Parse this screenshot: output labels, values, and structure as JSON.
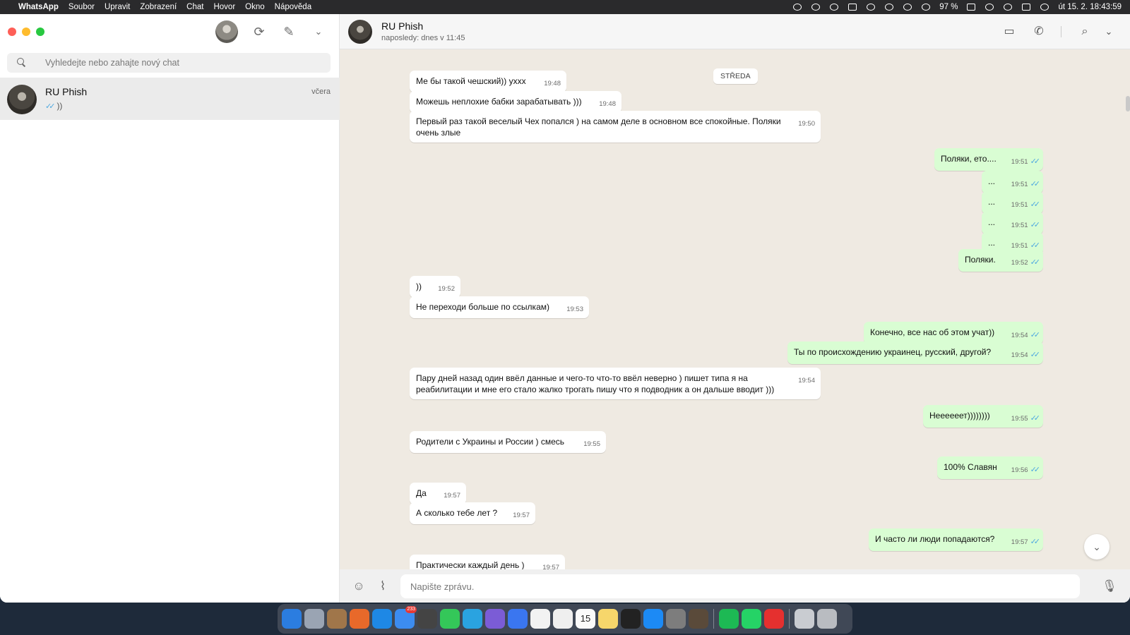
{
  "menubar": {
    "app_name": "WhatsApp",
    "menus": [
      "Soubor",
      "Upravit",
      "Zobrazení",
      "Chat",
      "Hovor",
      "Okno",
      "Nápověda"
    ],
    "battery": "97 %",
    "datetime": "út 15. 2.  18:43:59"
  },
  "sidebar": {
    "search_placeholder": "Vyhledejte nebo zahajte nový chat",
    "chat": {
      "name": "RU Phish",
      "time": "včera",
      "preview": "))"
    }
  },
  "conversation": {
    "contact_name": "RU Phish",
    "status": "naposledy: dnes v 11:45",
    "day_chip": "STŘEDA",
    "composer_placeholder": "Napište zprávu.",
    "messages": [
      {
        "dir": "in",
        "text": "Ме бы такой чешский)) ухxx",
        "time": "19:48"
      },
      {
        "dir": "in",
        "text": "Можешь неплохие бабки зарабатывать )))",
        "time": "19:48"
      },
      {
        "dir": "in",
        "text": "Первый раз такой веселый Чех попался ) на самом деле в основном все спокойные. Поляки очень злые",
        "time": "19:50"
      },
      {
        "dir": "out",
        "text": "Поляки, ето....",
        "time": "19:51"
      },
      {
        "dir": "out",
        "text": "...",
        "time": "19:51"
      },
      {
        "dir": "out",
        "text": "...",
        "time": "19:51"
      },
      {
        "dir": "out",
        "text": "...",
        "time": "19:51"
      },
      {
        "dir": "out",
        "text": "...",
        "time": "19:51"
      },
      {
        "dir": "out",
        "text": "Поляки.",
        "time": "19:52"
      },
      {
        "dir": "in",
        "text": "))",
        "time": "19:52"
      },
      {
        "dir": "in",
        "text": "Не переходи больше по ссылкам)",
        "time": "19:53"
      },
      {
        "dir": "out",
        "text": "Конечно, все нас об этом учат))",
        "time": "19:54"
      },
      {
        "dir": "out",
        "text": "Ты по происхождению украинец, русский, другой?",
        "time": "19:54"
      },
      {
        "dir": "in",
        "text": "Пару дней назад один ввёл данные и чего-то что-то ввёл неверно ) пишет типа я на реабилитации и мне его стало жалко трогать пишу что я подводник а он дальше вводит )))",
        "time": "19:54"
      },
      {
        "dir": "out",
        "text": "Неееееет))))))))",
        "time": "19:55"
      },
      {
        "dir": "in",
        "text": "Родители с Украины и России ) смесь",
        "time": "19:55"
      },
      {
        "dir": "out",
        "text": "100% Славян",
        "time": "19:56"
      },
      {
        "dir": "in",
        "text": "Да",
        "time": "19:57"
      },
      {
        "dir": "in",
        "text": "А сколько тебе лет ?",
        "time": "19:57"
      },
      {
        "dir": "out",
        "text": "И часто ли люди попадаются?",
        "time": "19:57"
      },
      {
        "dir": "in",
        "text": "Практически каждый день )",
        "time": "19:57"
      }
    ]
  },
  "dock": {
    "mail_badge": "233",
    "calendar_day": "15",
    "apps": [
      "finder-icon",
      "launchpad-icon",
      "notes-brown-icon",
      "firefox-icon",
      "safari-icon",
      "mail-icon",
      "calculator-icon",
      "messages-icon",
      "telegram-icon",
      "viber-icon",
      "signal-icon",
      "reminders-icon",
      "textedit-icon",
      "calendar-icon",
      "notes-icon",
      "capcut-icon",
      "appstore-icon",
      "settings-icon",
      "pdf-icon",
      "spotify-icon",
      "whatsapp-icon",
      "anydesk-icon",
      "folder-icon",
      "trash-icon"
    ]
  },
  "colors": {
    "outgoing_bubble": "#d9fdd3",
    "incoming_bubble": "#ffffff",
    "chat_bg": "#efeae2",
    "read_ticks": "#4ea8e0"
  }
}
